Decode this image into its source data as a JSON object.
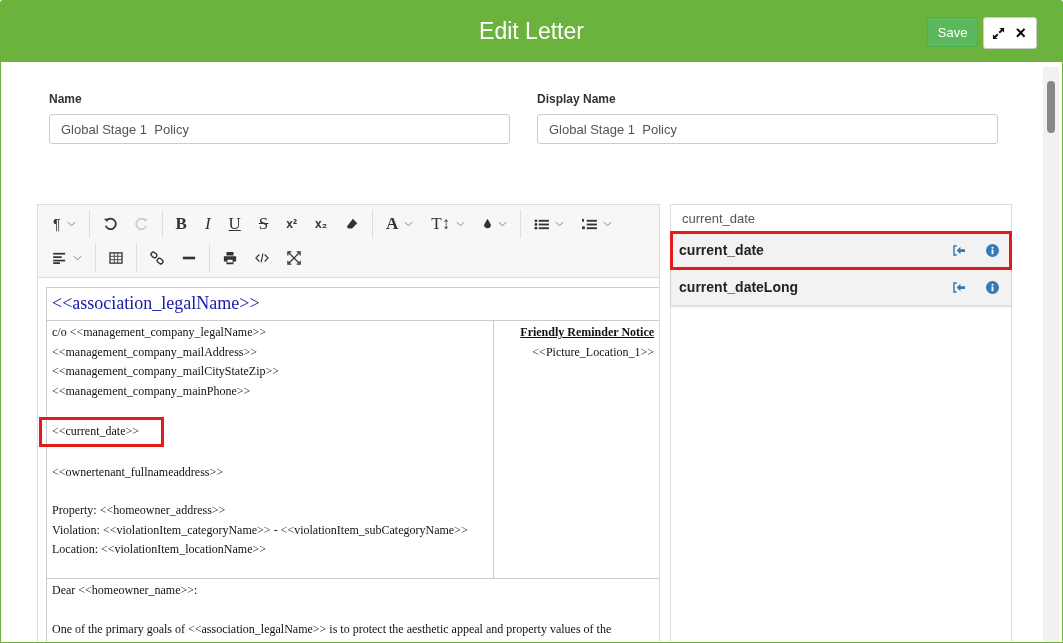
{
  "header": {
    "title": "Edit Letter",
    "save": "Save",
    "close": "×"
  },
  "fields": [
    {
      "label": "Name",
      "value": "Global Stage 1  Policy"
    },
    {
      "label": "Display Name",
      "value": "Global Stage 1  Policy"
    }
  ],
  "toolbar": {
    "paragraph": "¶",
    "redo_disabled": true,
    "bold": "B",
    "italic": "I",
    "underline": "U",
    "strike": "S",
    "superscript": "x²",
    "subscript": "x₂",
    "font": "A",
    "size": "T↕"
  },
  "letter": {
    "heading": "<<association_legalName>>",
    "blocks": [
      {
        "highlighted": false,
        "lines": [
          "c/o <<management_company_legalName>>",
          "<<management_company_mailAddress>>",
          "<<management_company_mailCityStateZip>>",
          "<<management_company_mainPhone>>"
        ]
      },
      {
        "highlighted": true,
        "lines": [
          "<<current_date>>"
        ]
      },
      {
        "highlighted": false,
        "lines": [
          "<<ownertenant_fullnameaddress>>"
        ]
      },
      {
        "highlighted": false,
        "lines": [
          "Property: <<homeowner_address>>",
          "Violation: <<violationItem_categoryName>> - <<violationItem_subCategoryName>>",
          "Location: <<violationItem_locationName>>"
        ]
      }
    ],
    "notice_title": "Friendly Reminder Notice",
    "picture": "<<Picture_Location_1>>",
    "body": [
      "Dear <<homeowner_name>>:",
      "One of the primary goals of <<association_legalName>> is to protect the aesthetic appeal and property values of the"
    ]
  },
  "fields_panel": {
    "search": "current_date",
    "results": [
      {
        "name": "current_date",
        "highlighted": true
      },
      {
        "name": "current_dateLong",
        "highlighted": false
      }
    ]
  }
}
